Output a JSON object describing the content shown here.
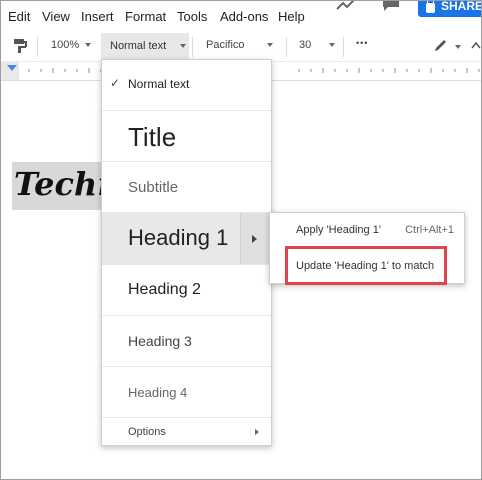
{
  "menubar": {
    "items": [
      "Edit",
      "View",
      "Insert",
      "Format",
      "Tools",
      "Add-ons",
      "Help"
    ],
    "share_label": "SHARE"
  },
  "toolbar": {
    "zoom": "100%",
    "style": "Normal text",
    "font": "Pacifico",
    "font_size": "30",
    "more": "•••"
  },
  "document": {
    "visible_text": "Techno"
  },
  "style_menu": {
    "items": [
      {
        "label": "Normal text",
        "checked": true
      },
      {
        "label": "Title"
      },
      {
        "label": "Subtitle"
      },
      {
        "label": "Heading 1"
      },
      {
        "label": "Heading 2"
      },
      {
        "label": "Heading 3"
      },
      {
        "label": "Heading 4"
      },
      {
        "label": "Options"
      }
    ]
  },
  "submenu": {
    "apply_label": "Apply 'Heading 1'",
    "apply_shortcut": "Ctrl+Alt+1",
    "update_label": "Update 'Heading 1' to match"
  },
  "colors": {
    "share_blue": "#1a73e8",
    "highlight_red": "#e0454f",
    "selected_bg": "#e0e0e0"
  }
}
